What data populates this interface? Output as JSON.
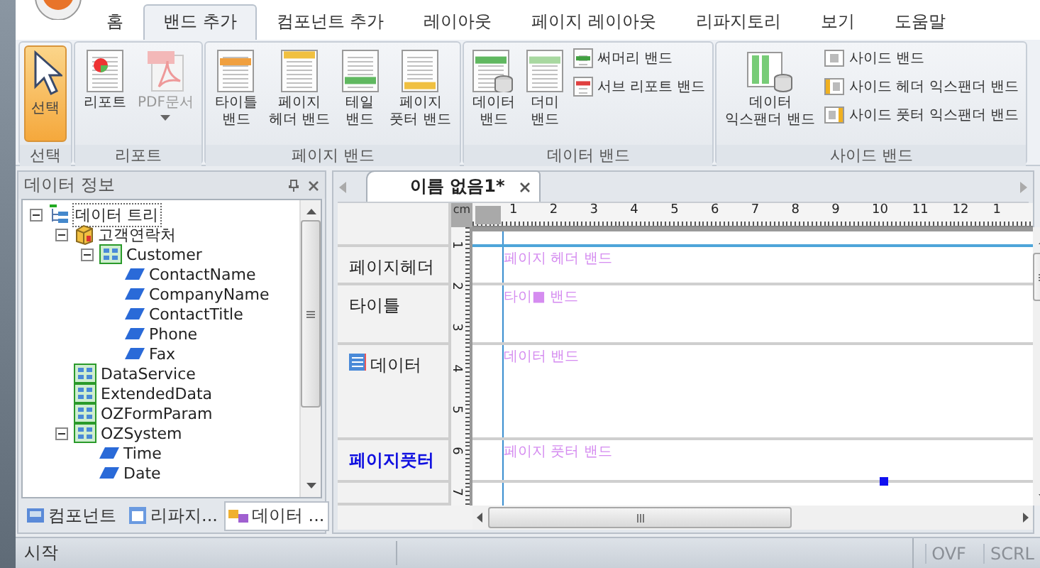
{
  "menu_tabs": [
    {
      "label": "홈",
      "selected": false
    },
    {
      "label": "밴드 추가",
      "selected": true
    },
    {
      "label": "컴포넌트 추가",
      "selected": false
    },
    {
      "label": "레이아웃",
      "selected": false
    },
    {
      "label": "페이지 레이아웃",
      "selected": false
    },
    {
      "label": "리파지토리",
      "selected": false
    },
    {
      "label": "보기",
      "selected": false
    },
    {
      "label": "도움말",
      "selected": false
    }
  ],
  "ribbon_groups": [
    {
      "title": "선택",
      "buttons": [
        {
          "label": "선택",
          "kind": "large",
          "selected": true,
          "disabled": false
        }
      ]
    },
    {
      "title": "리포트",
      "buttons": [
        {
          "label": "리포트",
          "kind": "large",
          "selected": false,
          "disabled": false
        },
        {
          "label": "PDF문서",
          "kind": "split",
          "selected": false,
          "disabled": true
        }
      ]
    },
    {
      "title": "페이지 밴드",
      "buttons": [
        {
          "label": "타이틀\n밴드",
          "kind": "large",
          "selected": false,
          "disabled": false
        },
        {
          "label": "페이지\n헤더 밴드",
          "kind": "large",
          "selected": false,
          "disabled": false
        },
        {
          "label": "테일\n밴드",
          "kind": "large",
          "selected": false,
          "disabled": false
        },
        {
          "label": "페이지\n풋터 밴드",
          "kind": "large",
          "selected": false,
          "disabled": false
        }
      ]
    },
    {
      "title": "데이터 밴드",
      "buttons": [
        {
          "label": "데이터\n밴드",
          "kind": "large",
          "selected": false,
          "disabled": false
        },
        {
          "label": "더미\n밴드",
          "kind": "large",
          "selected": false,
          "disabled": false
        },
        {
          "label": "써머리 밴드",
          "kind": "small",
          "selected": false,
          "disabled": false
        },
        {
          "label": "서브 리포트 밴드",
          "kind": "small",
          "selected": false,
          "disabled": false
        }
      ]
    },
    {
      "title": "사이드 밴드",
      "buttons": [
        {
          "label": "데이터\n익스팬더 밴드",
          "kind": "large",
          "selected": false,
          "disabled": false
        },
        {
          "label": "사이드 밴드",
          "kind": "small",
          "selected": false,
          "disabled": false
        },
        {
          "label": "사이드 헤더 익스팬더 밴드",
          "kind": "small",
          "selected": false,
          "disabled": false
        },
        {
          "label": "사이드 풋터 익스팬더 밴드",
          "kind": "small",
          "selected": false,
          "disabled": false
        }
      ]
    }
  ],
  "data_panel": {
    "title": "데이터 정보",
    "tree": [
      {
        "label": "데이터 트리",
        "kind": "root",
        "expanded": true,
        "children": [
          {
            "label": "고객연락처",
            "kind": "source",
            "expanded": true,
            "children": [
              {
                "label": "Customer",
                "kind": "set",
                "expanded": true,
                "children": [
                  {
                    "label": "ContactName",
                    "kind": "field"
                  },
                  {
                    "label": "CompanyName",
                    "kind": "field"
                  },
                  {
                    "label": "ContactTitle",
                    "kind": "field"
                  },
                  {
                    "label": "Phone",
                    "kind": "field"
                  },
                  {
                    "label": "Fax",
                    "kind": "field"
                  }
                ]
              }
            ]
          },
          {
            "label": "DataService",
            "kind": "set"
          },
          {
            "label": "ExtendedData",
            "kind": "set"
          },
          {
            "label": "OZFormParam",
            "kind": "set"
          },
          {
            "label": "OZSystem",
            "kind": "set",
            "expanded": true,
            "children": [
              {
                "label": "Time",
                "kind": "field"
              },
              {
                "label": "Date",
                "kind": "field"
              }
            ]
          }
        ]
      }
    ],
    "tabs": [
      {
        "label": "컴포넌트",
        "selected": false
      },
      {
        "label": "리파지...",
        "selected": false
      },
      {
        "label": "데이터 ...",
        "selected": true
      }
    ]
  },
  "document": {
    "tab_title": "이름 없음1*",
    "ruler_unit": "cm",
    "ruler_numbers": [
      "1",
      "2",
      "3",
      "4",
      "5",
      "6",
      "7",
      "8",
      "9",
      "10",
      "11",
      "12",
      "1"
    ],
    "vertical_ruler_numbers": [
      "1",
      "2",
      "3",
      "4",
      "5",
      "6",
      "7"
    ],
    "bands": [
      {
        "label": "페이지헤더",
        "band_title": "페이지 헤더 밴드",
        "kind": "page_header",
        "selected": false
      },
      {
        "label": "타이틀",
        "band_title": "타이■ 밴드",
        "kind": "title",
        "selected": false
      },
      {
        "label": "데이터",
        "band_title": "데이터 밴드",
        "kind": "data",
        "selected": false
      },
      {
        "label": "페이지풋터",
        "band_title": "페이지 풋터 밴드",
        "kind": "page_footer",
        "selected": true
      }
    ]
  },
  "status_bar": {
    "text": "시작",
    "indicators": [
      "OVF",
      "SCRL"
    ]
  }
}
